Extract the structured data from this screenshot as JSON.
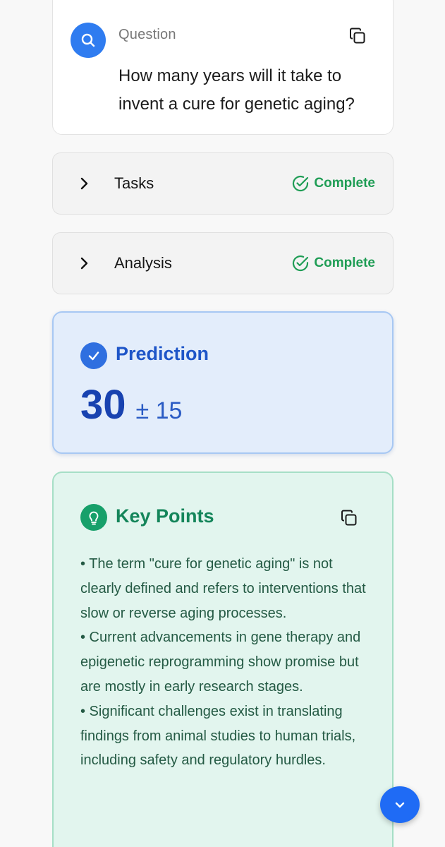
{
  "question": {
    "label": "Question",
    "text": "How many years will it take to invent a cure for genetic aging?"
  },
  "steps": [
    {
      "label": "Tasks",
      "status": "Complete"
    },
    {
      "label": "Analysis",
      "status": "Complete"
    }
  ],
  "prediction": {
    "title": "Prediction",
    "value": "30",
    "range": "± 15"
  },
  "key_points": {
    "title": "Key Points",
    "items": [
      "• The term \"cure for genetic aging\" is not clearly defined and refers to interventions that slow or reverse aging processes.",
      "• Current advancements in gene therapy and epigenetic reprogramming show promise but are mostly in early research stages.",
      "• Significant challenges exist in translating findings from animal studies to human trials, including safety and regulatory hurdles."
    ]
  },
  "colors": {
    "accent_blue": "#2f7cf0",
    "complete_green": "#1f9d55",
    "prediction_bg": "#e3edfb",
    "keypoints_bg": "#e2f5ee"
  },
  "icons": {
    "question": "search-icon",
    "copy": "copy-icon",
    "expand": "chevron-right-icon",
    "status": "check-circle-icon",
    "prediction": "check-icon",
    "key_points": "lightbulb-icon",
    "scroll": "chevron-down-icon"
  }
}
